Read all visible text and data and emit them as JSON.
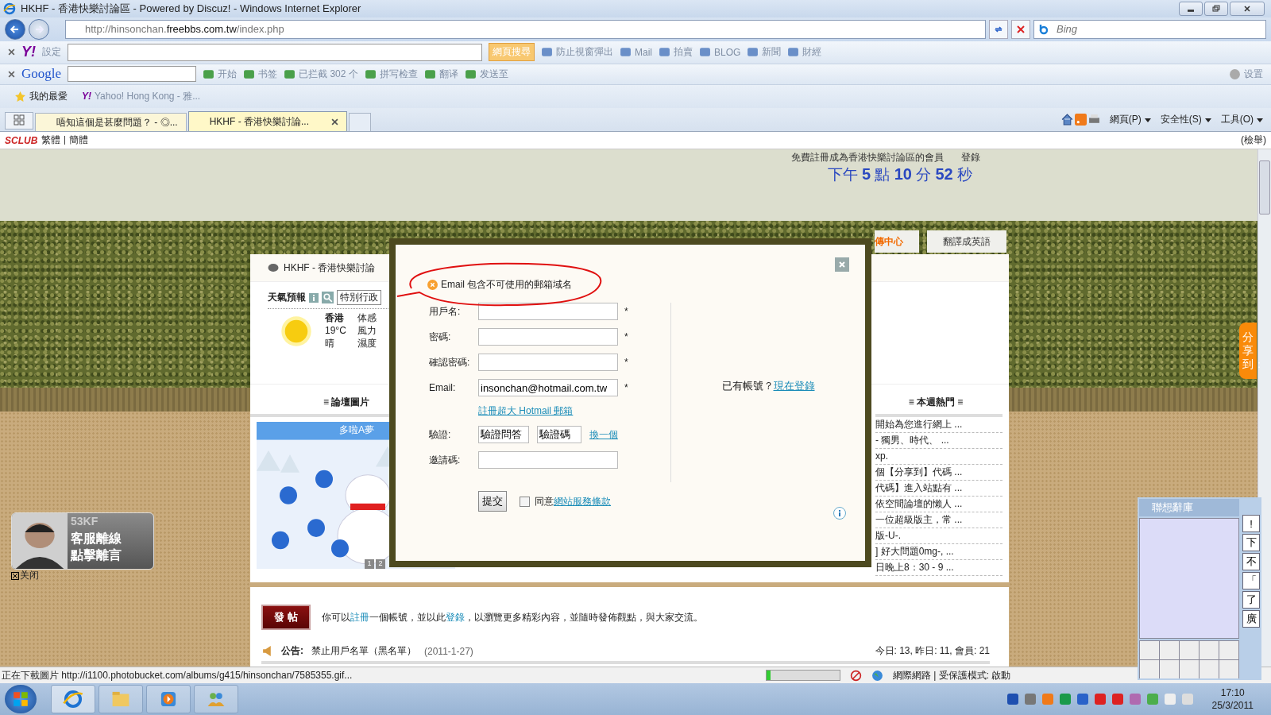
{
  "window": {
    "title": "HKHF - 香港快樂討論區 - Powered by Discuz! - Windows Internet Explorer"
  },
  "address": {
    "url_prefix": "http://hinsonchan.",
    "url_domain": "freebbs.com.tw",
    "url_suffix": "/index.php",
    "search_placeholder": "Bing"
  },
  "yahoo_toolbar": {
    "logo": "Y!",
    "setting": "設定",
    "search_button": "網頁搜尋",
    "items": [
      "防止視窗彈出",
      "Mail",
      "拍賣",
      "BLOG",
      "新聞",
      "財經"
    ]
  },
  "google_toolbar": {
    "logo": "Google",
    "items": [
      "开始",
      "书签",
      "已拦截 302 个",
      "拼写检查",
      "翻译",
      "发送至"
    ],
    "settings": "设置"
  },
  "favorites": {
    "label": "我的最愛",
    "logo": "Y!",
    "items": [
      "Yahoo! Hong Kong - 雅..."
    ]
  },
  "tabs": [
    {
      "label": "唔知這個是甚麼問題？ - ◎...",
      "selected": false
    },
    {
      "label": "HKHF - 香港快樂討論...",
      "selected": true
    }
  ],
  "command_bar": [
    "網頁(P)",
    "安全性(S)",
    "工具(O)"
  ],
  "site_bar": {
    "logo": "SCLUB",
    "links": [
      "繁體",
      "簡體"
    ],
    "report": "(檢舉)"
  },
  "header": {
    "register": "免費註冊成為香港快樂討論區的會員",
    "login": "登錄",
    "clock": "下午 **5** 點 **10** 分 **52** 秒"
  },
  "nav_tabs": [
    {
      "label": "傳中心",
      "kind": "highlight"
    },
    {
      "label": "翻譯成英語",
      "kind": "plain"
    }
  ],
  "forum": {
    "title": "HKHF - 香港快樂討論",
    "weather": {
      "title": "天氣預報",
      "region": "特別行政",
      "city": "香港",
      "temp": "19°C",
      "condition": "晴",
      "labels": [
        "体感",
        "風力",
        "濕度"
      ]
    },
    "pictures_heading": "≡ 論壇圖片",
    "picture_caption": "多啦A夢",
    "pager": [
      "1",
      "2"
    ],
    "hot_heading": "≡ 本週熱門 ≡",
    "hot_items": [
      "開始為您進行網上 ...",
      "- 獨男、時代、 ...",
      "xp.",
      "個【分享到】代碼 ...",
      "代碼】進入站點有 ...",
      "依空間論壇的懶人 ...",
      "一位超級版主，常 ...",
      "版-U-.",
      "] 好大問題0mg-, ...",
      "日晚上8：30 - 9 ..."
    ],
    "post_button": "發 帖",
    "post_hint": [
      {
        "text": "你可以",
        "link": false
      },
      {
        "text": "註冊",
        "link": true
      },
      {
        "text": "一個帳號，並以此",
        "link": false
      },
      {
        "text": "登錄",
        "link": true
      },
      {
        "text": "，以瀏覽更多精彩內容，並隨時發佈觀點，與大家交流。",
        "link": false
      }
    ],
    "notice_label": "公告:",
    "notice": "禁止用戶名單（黑名單）",
    "notice_date": "(2011-1-27)",
    "stats": "今日: 13, 昨日: 11, 會員: 21"
  },
  "side_ad": {
    "brand": "53KF",
    "line1": "客服離線",
    "line2": "點擊離言",
    "close": "关闭"
  },
  "share_tab": "分享到：",
  "ime": {
    "title": "聯想辭庫",
    "keys": [
      "!",
      "下",
      "不",
      "「",
      "了",
      "廣"
    ]
  },
  "modal": {
    "error": "Email 包含不可使用的郵箱域名",
    "fields": [
      {
        "label": "用戶名:",
        "mark": "*"
      },
      {
        "label": "密碼:",
        "mark": "*"
      },
      {
        "label": "確認密碼:",
        "mark": "*"
      },
      {
        "label": "Email:",
        "value": "insonchan@hotmail.com.tw",
        "mark": "*"
      }
    ],
    "hotmail_link": "註冊超大 Hotmail 郵箱",
    "verify_label": "驗證:",
    "verify_answer": "驗證問答",
    "verify_code": "驗證碼",
    "refresh": "換一個",
    "invite_label": "邀請碼:",
    "submit": "提交",
    "agree_checked": false,
    "agree": "同意",
    "terms": "網站服務條款",
    "have_account": "已有帳號？",
    "login_now": "現在登錄"
  },
  "status_bar": {
    "text": "正在下載圖片 http://i1100.photobucket.com/albums/g415/hinsonchan/7585355.gif...",
    "level": 0.05,
    "zone": "網際網路 | 受保護模式: 啟動"
  },
  "taskbar": {
    "time": "17:10",
    "date": "25/3/2011"
  }
}
